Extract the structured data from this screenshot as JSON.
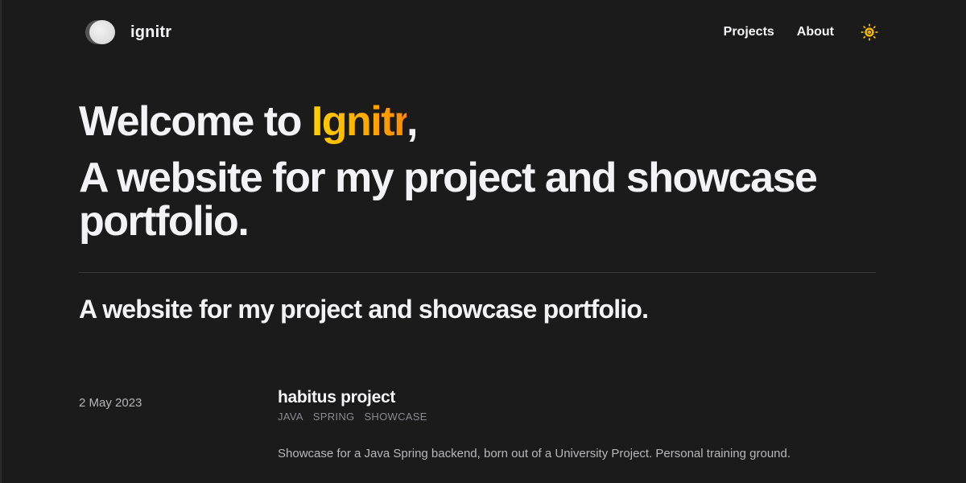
{
  "header": {
    "brand_name": "ignitr",
    "nav": [
      {
        "label": "Projects"
      },
      {
        "label": "About"
      }
    ],
    "theme_icon": "sun-icon"
  },
  "hero": {
    "welcome_prefix": "Welcome to ",
    "welcome_accent": "Ignitr",
    "welcome_suffix": ",",
    "tagline": "A website for my project and showcase portfolio."
  },
  "subtitle": "A website for my project and showcase portfolio.",
  "posts": [
    {
      "date": "2 May 2023",
      "title": "habitus project",
      "tags": [
        "JAVA",
        "SPRING",
        "SHOWCASE"
      ],
      "description": "Showcase for a Java Spring backend, born out of a University Project. Personal training ground."
    }
  ],
  "colors": {
    "background": "#1b1b1b",
    "text": "#f3f3f5",
    "accent_start": "#ffd000",
    "accent_end": "#ff8a00",
    "sun_icon": "#f5b700",
    "muted": "#8a8a90"
  }
}
